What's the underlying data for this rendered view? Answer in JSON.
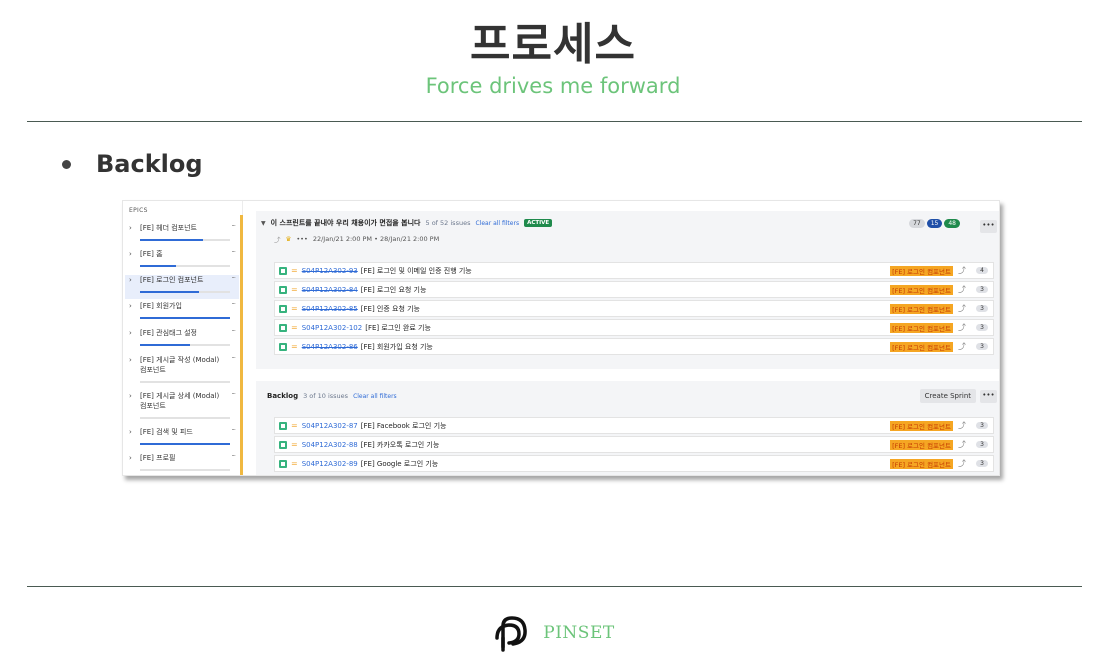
{
  "header": {
    "title": "프로세스",
    "subtitle": "Force drives me forward"
  },
  "section": {
    "bullet": "Backlog"
  },
  "screenshot": {
    "epics": {
      "heading": "EPICS",
      "items": [
        {
          "label": "[FE] 헤더 컴포넌트",
          "progress": 0.7
        },
        {
          "label": "[FE] 홈",
          "progress": 0.4
        },
        {
          "label": "[FE] 로그인 컴포넌트",
          "progress": 0.65
        },
        {
          "label": "[FE] 회원가입",
          "progress": 1.0
        },
        {
          "label": "[FE] 관심태그 설정",
          "progress": 0.55
        },
        {
          "label": "[FE] 게시글 작성 (Modal) 컴포넌트",
          "progress": 0.0
        },
        {
          "label": "[FE] 게시글 상세 (Modal) 컴포넌트",
          "progress": 0.0
        },
        {
          "label": "[FE] 검색 및 피드",
          "progress": 1.0
        },
        {
          "label": "[FE] 프로필",
          "progress": 0.0
        }
      ]
    },
    "sprint": {
      "name": "이 스프린트를 끝내야 우리 채용이가 면접을 봅니다",
      "count": "5 of 52 issues",
      "clear": "Clear all filters",
      "status": "ACTIVE",
      "dates": "22/Jan/21 2:00 PM • 28/Jan/21 2:00 PM",
      "more": "•••",
      "points": {
        "todo": "77",
        "progress": "15",
        "done": "48"
      },
      "menu": "•••",
      "issues": [
        {
          "key": "S04P12A302-93",
          "summary": "[FE] 로그인 및 이메일 인증 진행 기능",
          "epic": "[FE] 로그인 컴포넌트",
          "points": "4",
          "done": true
        },
        {
          "key": "S04P12A302-84",
          "summary": "[FE] 로그인 요청 기능",
          "epic": "[FE] 로그인 컴포넌트",
          "points": "3",
          "done": true
        },
        {
          "key": "S04P12A302-85",
          "summary": "[FE] 인증 요청 기능",
          "epic": "[FE] 로그인 컴포넌트",
          "points": "3",
          "done": true
        },
        {
          "key": "S04P12A302-102",
          "summary": "[FE] 로그인 완료 기능",
          "epic": "[FE] 로그인 컴포넌트",
          "points": "3",
          "done": false
        },
        {
          "key": "S04P12A302-86",
          "summary": "[FE] 회원가입 요청 기능",
          "epic": "[FE] 로그인 컴포넌트",
          "points": "3",
          "done": true
        }
      ]
    },
    "backlog": {
      "name": "Backlog",
      "count": "3 of 10 issues",
      "clear": "Clear all filters",
      "create_sprint": "Create Sprint",
      "menu": "•••",
      "issues": [
        {
          "key": "S04P12A302-87",
          "summary": "[FE] Facebook 로그인 기능",
          "epic": "[FE] 로그인 컴포넌트",
          "points": "3",
          "done": false
        },
        {
          "key": "S04P12A302-88",
          "summary": "[FE] 카카오톡 로그인 기능",
          "epic": "[FE] 로그인 컴포넌트",
          "points": "3",
          "done": false
        },
        {
          "key": "S04P12A302-89",
          "summary": "[FE] Google 로그인 기능",
          "epic": "[FE] 로그인 컴포넌트",
          "points": "3",
          "done": false
        }
      ]
    }
  },
  "footer": {
    "brand": "PINSET",
    "logo_icon": "pinset-logo-icon"
  },
  "colors": {
    "accent_green": "#6cc47a",
    "epic_tag": "#f5a623",
    "link_blue": "#2f6bd6"
  }
}
